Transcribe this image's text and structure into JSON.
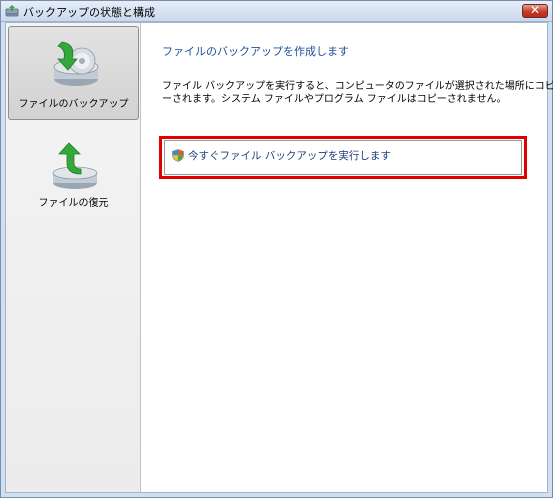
{
  "window": {
    "title": "バックアップの状態と構成",
    "close_glyph": "✕"
  },
  "sidebar": {
    "items": [
      {
        "label": "ファイルのバックアップ",
        "icon": "backup-disk-icon",
        "selected": true
      },
      {
        "label": "ファイルの復元",
        "icon": "restore-disk-icon",
        "selected": false
      }
    ]
  },
  "main": {
    "heading": "ファイルのバックアップを作成します",
    "description_lines": [
      "ファイル バックアップを実行すると、コンピュータのファイルが選択された場所にコピ",
      "ーされます。システム ファイルやプログラム ファイルはコピーされません。"
    ],
    "action": {
      "label": "今すぐファイル バックアップを実行します",
      "icon": "uac-shield-icon"
    }
  },
  "colors": {
    "heading": "#1c4f9a",
    "highlight_border": "#e00000",
    "action_text": "#1c3f7a"
  }
}
